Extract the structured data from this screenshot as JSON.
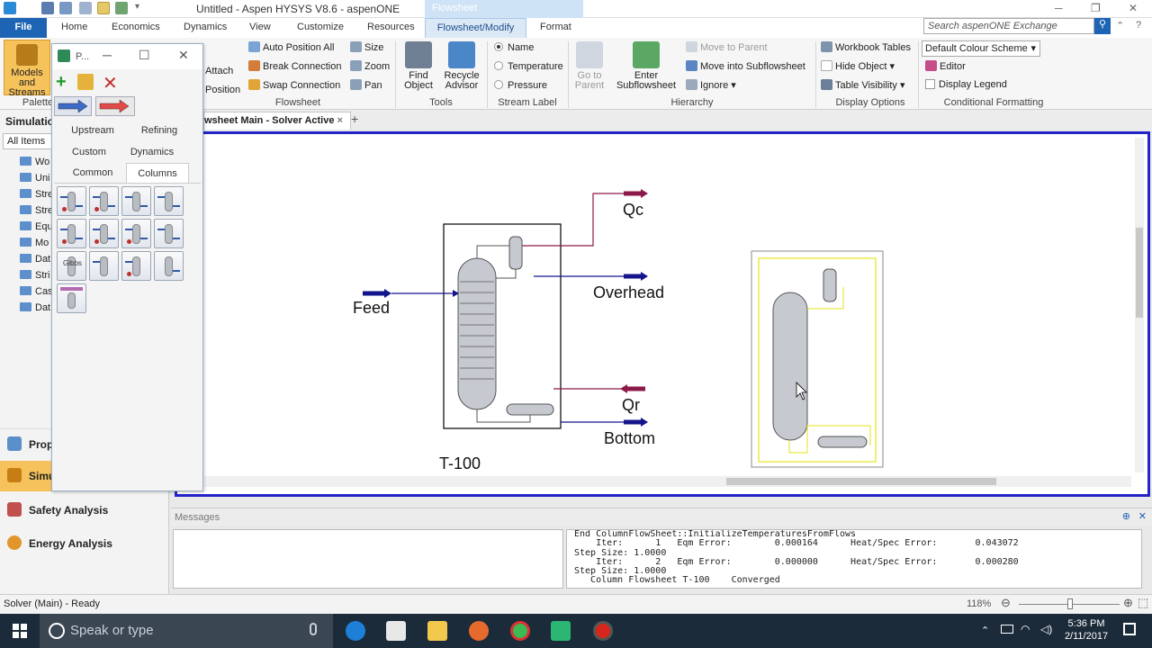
{
  "window": {
    "title": "Untitled - Aspen HYSYS V8.6 - aspenONE",
    "context_tab_label": "Flowsheet"
  },
  "ribbon_tabs": {
    "file": "File",
    "home": "Home",
    "economics": "Economics",
    "dynamics": "Dynamics",
    "view": "View",
    "customize": "Customize",
    "resources": "Resources",
    "flowsheet_modify": "Flowsheet/Modify",
    "format": "Format"
  },
  "search": {
    "placeholder": "Search aspenONE Exchange"
  },
  "ribbon": {
    "models_streams": "Models and Streams",
    "palette_group": "Palette",
    "attach": "Attach",
    "position": "Position",
    "auto_position_all": "Auto Position All",
    "break_connection": "Break Connection",
    "swap_connection": "Swap Connection",
    "size": "Size",
    "zoom": "Zoom",
    "pan": "Pan",
    "flowsheet_group": "Flowsheet",
    "find_object_1": "Find",
    "find_object_2": "Object",
    "recycle_advisor_1": "Recycle",
    "recycle_advisor_2": "Advisor",
    "tools_group": "Tools",
    "name": "Name",
    "temperature": "Temperature",
    "pressure": "Pressure",
    "stream_label_group": "Stream Label",
    "go_to_parent_1": "Go to",
    "go_to_parent_2": "Parent",
    "enter_subflowsheet_1": "Enter",
    "enter_subflowsheet_2": "Subflowsheet",
    "move_to_parent": "Move to Parent",
    "move_into_subflowsheet": "Move into Subflowsheet",
    "ignore": "Ignore",
    "hierarchy_group": "Hierarchy",
    "workbook_tables": "Workbook Tables",
    "hide_object": "Hide Object",
    "table_visibility": "Table Visibility",
    "display_options_group": "Display Options",
    "colour_scheme": "Default Colour Scheme",
    "editor": "Editor",
    "display_legend": "Display Legend",
    "conditional_formatting_group": "Conditional Formatting"
  },
  "nav": {
    "tree_header": "Simulation",
    "filter": "All Items",
    "items": [
      "Wo",
      "Uni",
      "Stre",
      "Stre",
      "Equ",
      "Mo",
      "Dat",
      "Stri",
      "Cas",
      "Dat"
    ],
    "properties": "Prop",
    "simulation": "Simu",
    "safety_analysis": "Safety Analysis",
    "energy_analysis": "Energy Analysis"
  },
  "palette": {
    "title": "P...",
    "tabs": {
      "upstream": "Upstream",
      "refining": "Refining",
      "custom": "Custom",
      "dynamics": "Dynamics",
      "common": "Common",
      "columns": "Columns"
    },
    "gibbs_label": "Gibbs"
  },
  "flowsheet": {
    "tab_label": "wsheet Main - Solver Active",
    "close": "×",
    "add": "+",
    "streams": {
      "feed": "Feed",
      "qc": "Qc",
      "overhead": "Overhead",
      "qr": "Qr",
      "bottom": "Bottom"
    },
    "unit": "T-100"
  },
  "messages": {
    "header": "Messages",
    "log": [
      "End ColumnFlowSheet::InitializeTemperaturesFromFlows",
      "    Iter:      1   Eqm Error:        0.000164      Heat/Spec Error:       0.043072",
      "Step Size: 1.0000",
      "    Iter:      2   Eqm Error:        0.000000      Heat/Spec Error:       0.000280",
      "Step Size: 1.0000",
      "   Column Flowsheet T-100    Converged"
    ]
  },
  "status": {
    "solver": "Solver (Main) - Ready",
    "zoom": "118%"
  },
  "taskbar": {
    "search": "Speak or type",
    "time": "5:36 PM",
    "date": "2/11/2017"
  },
  "colors": {
    "accent": "#1e64b4",
    "energy_stream": "#8b1a4a",
    "material_stream": "#14148c",
    "canvas_border": "#2323c8"
  }
}
